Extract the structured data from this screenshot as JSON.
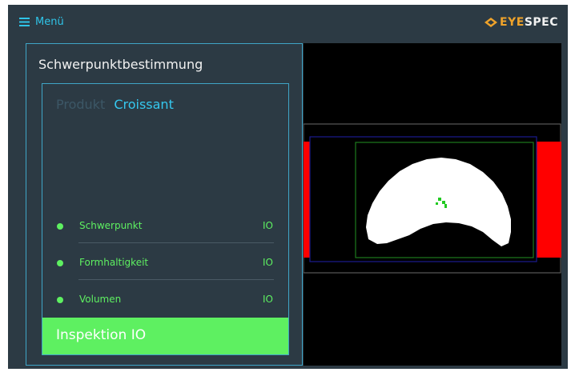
{
  "topbar": {
    "menu_label": "Menü",
    "logo_eye": "EYE",
    "logo_spec": "SPEC",
    "logo_mark_icon": "diamond-logo-icon"
  },
  "panel": {
    "title": "Schwerpunktbestimmung",
    "product_label": "Produkt",
    "product_value": "Croissant",
    "checks": [
      {
        "label": "Schwerpunkt",
        "status": "IO"
      },
      {
        "label": "Formhaltigkeit",
        "status": "IO"
      },
      {
        "label": "Volumen",
        "status": "IO"
      }
    ],
    "result": "Inspektion IO"
  },
  "colors": {
    "background": "#2c3a44",
    "accent": "#2fc4e8",
    "ok_green": "#5ef061",
    "border": "#3fa5c7",
    "mask_red": "#ff0000"
  }
}
